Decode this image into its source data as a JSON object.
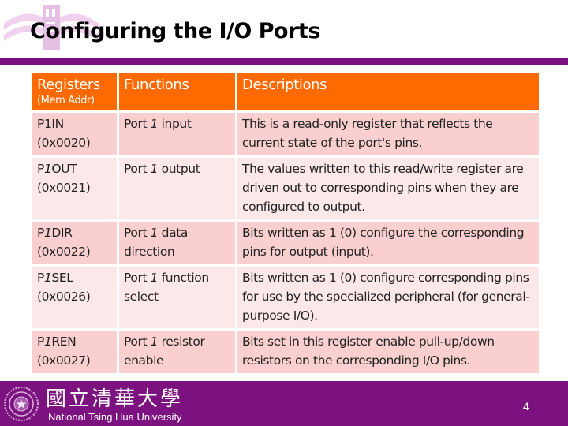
{
  "slide": {
    "title": "Configuring the I/O Ports",
    "page_number": "4"
  },
  "table": {
    "headers": {
      "registers": "Registers",
      "registers_sub": "(Mem Addr)",
      "functions": "Functions",
      "descriptions": "Descriptions"
    },
    "rows": [
      {
        "reg_prefix": "P1",
        "reg_suffix": "IN",
        "addr": "(0x0020)",
        "func_pre": "Port ",
        "func_num": "1",
        "func_post": " input",
        "desc": "This is a read-only register that reflects the current state of the port's pins."
      },
      {
        "reg_prefix": "P",
        "reg_num": "1",
        "reg_suffix": "OUT",
        "addr": "(0x0021)",
        "func_pre": "Port ",
        "func_num": "1",
        "func_post": " output",
        "desc": "The values written to this read/write register are driven out to corresponding pins when they are configured to output."
      },
      {
        "reg_prefix": "P",
        "reg_num": "1",
        "reg_suffix": "DIR",
        "addr": "(0x0022)",
        "func_pre": "Port ",
        "func_num": "1",
        "func_post": " data direction",
        "desc": "Bits written as 1 (0) configure the corresponding pins for output (input)."
      },
      {
        "reg_prefix": "P",
        "reg_num": "1",
        "reg_suffix": "SEL",
        "addr": "(0x0026)",
        "func_pre": "Port ",
        "func_num": "1",
        "func_post": " function select",
        "desc": "Bits written as 1 (0) configure corresponding pins for use by the specialized peripheral (for general-purpose I/O)."
      },
      {
        "reg_prefix": "P",
        "reg_num": "1",
        "reg_suffix": "REN",
        "addr": "(0x0027)",
        "func_pre": "Port ",
        "func_num": "1",
        "func_post": " resistor enable",
        "desc": "Bits set in this register enable  pull-up/down resistors on the corresponding I/O pins."
      }
    ]
  },
  "footer": {
    "university_cn": "國立清華大學",
    "university_en": "National Tsing Hua University"
  },
  "colors": {
    "accent_purple": "#7c127f",
    "header_orange": "#ff6a00",
    "row_dark": "#f9cfcf",
    "row_light": "#fce8e8"
  }
}
